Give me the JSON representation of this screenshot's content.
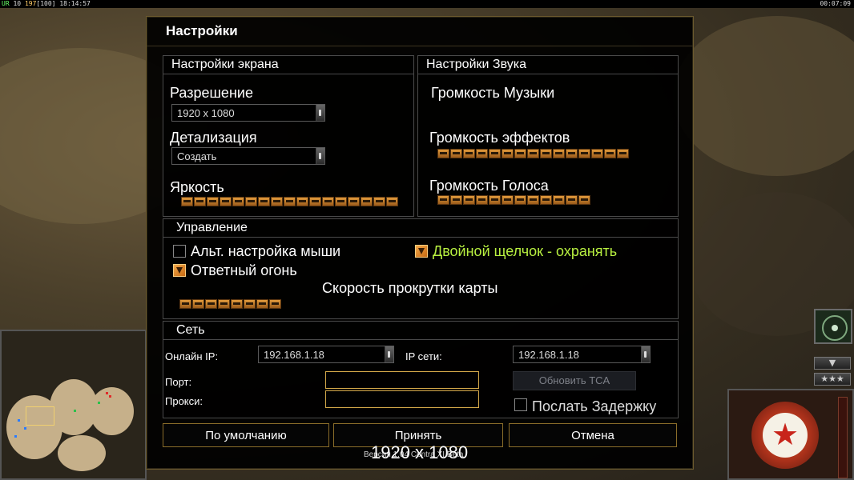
{
  "hud": {
    "left_prefix": "UR",
    "left_num1": "10",
    "left_num2": "197",
    "left_num3": "[100]",
    "left_time": "18:14:57",
    "right_time": "00:07:09"
  },
  "dialog": {
    "title": "Настройки",
    "display": {
      "header": "Настройки экрана",
      "resolution_label": "Разрешение",
      "resolution_value": "1920 x 1080",
      "detail_label": "Детализация",
      "detail_value": "Создать",
      "brightness_label": "Яркость",
      "brightness_segments": 17
    },
    "sound": {
      "header": "Настройки Звука",
      "music_label": "Громкость Музыки",
      "music_segments": 0,
      "effects_label": "Громкость эффектов",
      "effects_segments": 15,
      "voice_label": "Громкость Голоса",
      "voice_segments": 12
    },
    "controls": {
      "header": "Управление",
      "alt_mouse_label": "Альт. настройка мыши",
      "alt_mouse_checked": false,
      "double_click_label": "Двойной щелчок - охранять",
      "double_click_checked": true,
      "double_click_color": "#b8f040",
      "retaliation_label": "Ответный огонь",
      "retaliation_checked": true,
      "scroll_speed_label": "Скорость прокрутки карты",
      "scroll_speed_segments": 8
    },
    "network": {
      "header": "Сеть",
      "online_ip_label": "Онлайн IP:",
      "online_ip_value": "192.168.1.18",
      "lan_ip_label": "IP сети:",
      "lan_ip_value": "192.168.1.18",
      "port_label": "Порт:",
      "port_value": "",
      "proxy_label": "Прокси:",
      "proxy_value": "",
      "update_tca_button": "Обновить TCA",
      "send_delay_label": "Послать Задержку",
      "send_delay_checked": false
    },
    "buttons": {
      "defaults": "По умолчанию",
      "accept": "Принять",
      "cancel": "Отмена"
    }
  },
  "overlay": {
    "resolution_tooltip": "1920 x 1080",
    "version_text": "Версия 1.04 Contra XI Beta"
  },
  "right_hud": {
    "collapse_icon": "chevron-down-icon",
    "rank_text": "★★★"
  },
  "colors": {
    "accent_gold": "#8a6d2a",
    "slider_orange": "#e09a3c",
    "field_border": "#d4a94a"
  }
}
